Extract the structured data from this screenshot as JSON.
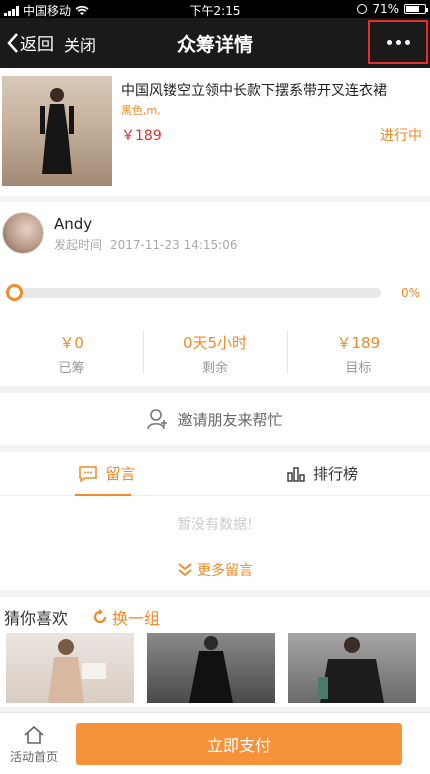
{
  "status_bar": {
    "carrier": "中国移动",
    "time": "下午2:15",
    "battery": "71%",
    "battery_level": 0.71
  },
  "nav": {
    "back_label": "返回",
    "close_label": "关闭",
    "title": "众筹详情",
    "more_icon": "more-dots-icon"
  },
  "product": {
    "title": "中国风镂空立领中长款下摆系带开叉连衣裙",
    "spec": "黑色,m,",
    "price": "￥189",
    "status": "进行中"
  },
  "initiator": {
    "name": "Andy",
    "time_label": "发起时间",
    "time": "2017-11-23 14:15:06"
  },
  "progress": {
    "percent_label": "0%",
    "value": 0
  },
  "stats": [
    {
      "value": "￥0",
      "label": "已筹"
    },
    {
      "value": "0天5小时",
      "label": "剩余"
    },
    {
      "value": "￥189",
      "label": "目标"
    }
  ],
  "invite": {
    "label": "邀请朋友来帮忙"
  },
  "tabs": [
    {
      "label": "留言",
      "icon": "comment-icon",
      "active": true
    },
    {
      "label": "排行榜",
      "icon": "ranking-icon",
      "active": false
    }
  ],
  "comments": {
    "empty_text": "暂没有数据!",
    "more_label": "更多留言"
  },
  "guess": {
    "title": "猜你喜欢",
    "refresh_label": "换一组"
  },
  "bottom": {
    "home_label": "活动首页",
    "pay_label": "立即支付"
  },
  "colors": {
    "accent": "#f08a2a",
    "price": "#e03030",
    "navbar": "#1a1a1a",
    "highlight_box": "#e03030"
  }
}
